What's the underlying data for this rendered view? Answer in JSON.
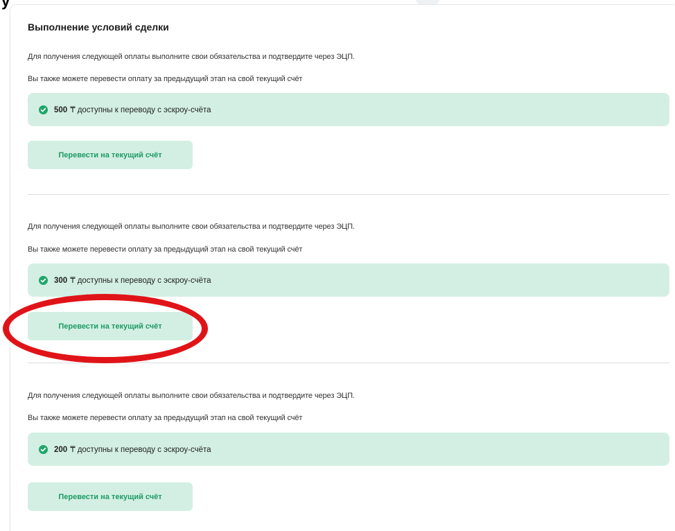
{
  "header": {
    "corner_char": "у"
  },
  "section": {
    "title": "Выполнение условий сделки"
  },
  "steps": [
    {
      "line1": "Для получения следующей оплаты выполните свои обязательства и подтвердите через ЭЦП.",
      "line2": "Вы также можете перевести оплату за предыдущий этап на свой текущий счёт",
      "banner_amount": "500",
      "banner_text": "₸ доступны к переводу с эскроу-счёта",
      "button_label": "Перевести на текущий счёт"
    },
    {
      "line1": "Для получения следующей оплаты выполните свои обязательства и подтвердите через ЭЦП.",
      "line2": "Вы также можете перевести оплату за предыдущий этап на свой текущий счёт",
      "banner_amount": "300",
      "banner_text": "₸ доступны к переводу с эскроу-счёта",
      "button_label": "Перевести на текущий счёт"
    },
    {
      "line1": "Для получения следующей оплаты выполните свои обязательства и подтвердите через ЭЦП.",
      "line2": "Вы также можете перевести оплату за предыдущий этап на свой текущий счёт",
      "banner_amount": "200",
      "banner_text": "₸ доступны к переводу с эскроу-счёта",
      "button_label": "Перевести на текущий счёт"
    }
  ],
  "icons": {
    "banner_icon": "check-circle-icon"
  },
  "colors": {
    "accent_green": "#21a66b",
    "banner_bg": "#d3efe3",
    "button_text": "#1f9a64",
    "highlight_red": "#e01418"
  }
}
